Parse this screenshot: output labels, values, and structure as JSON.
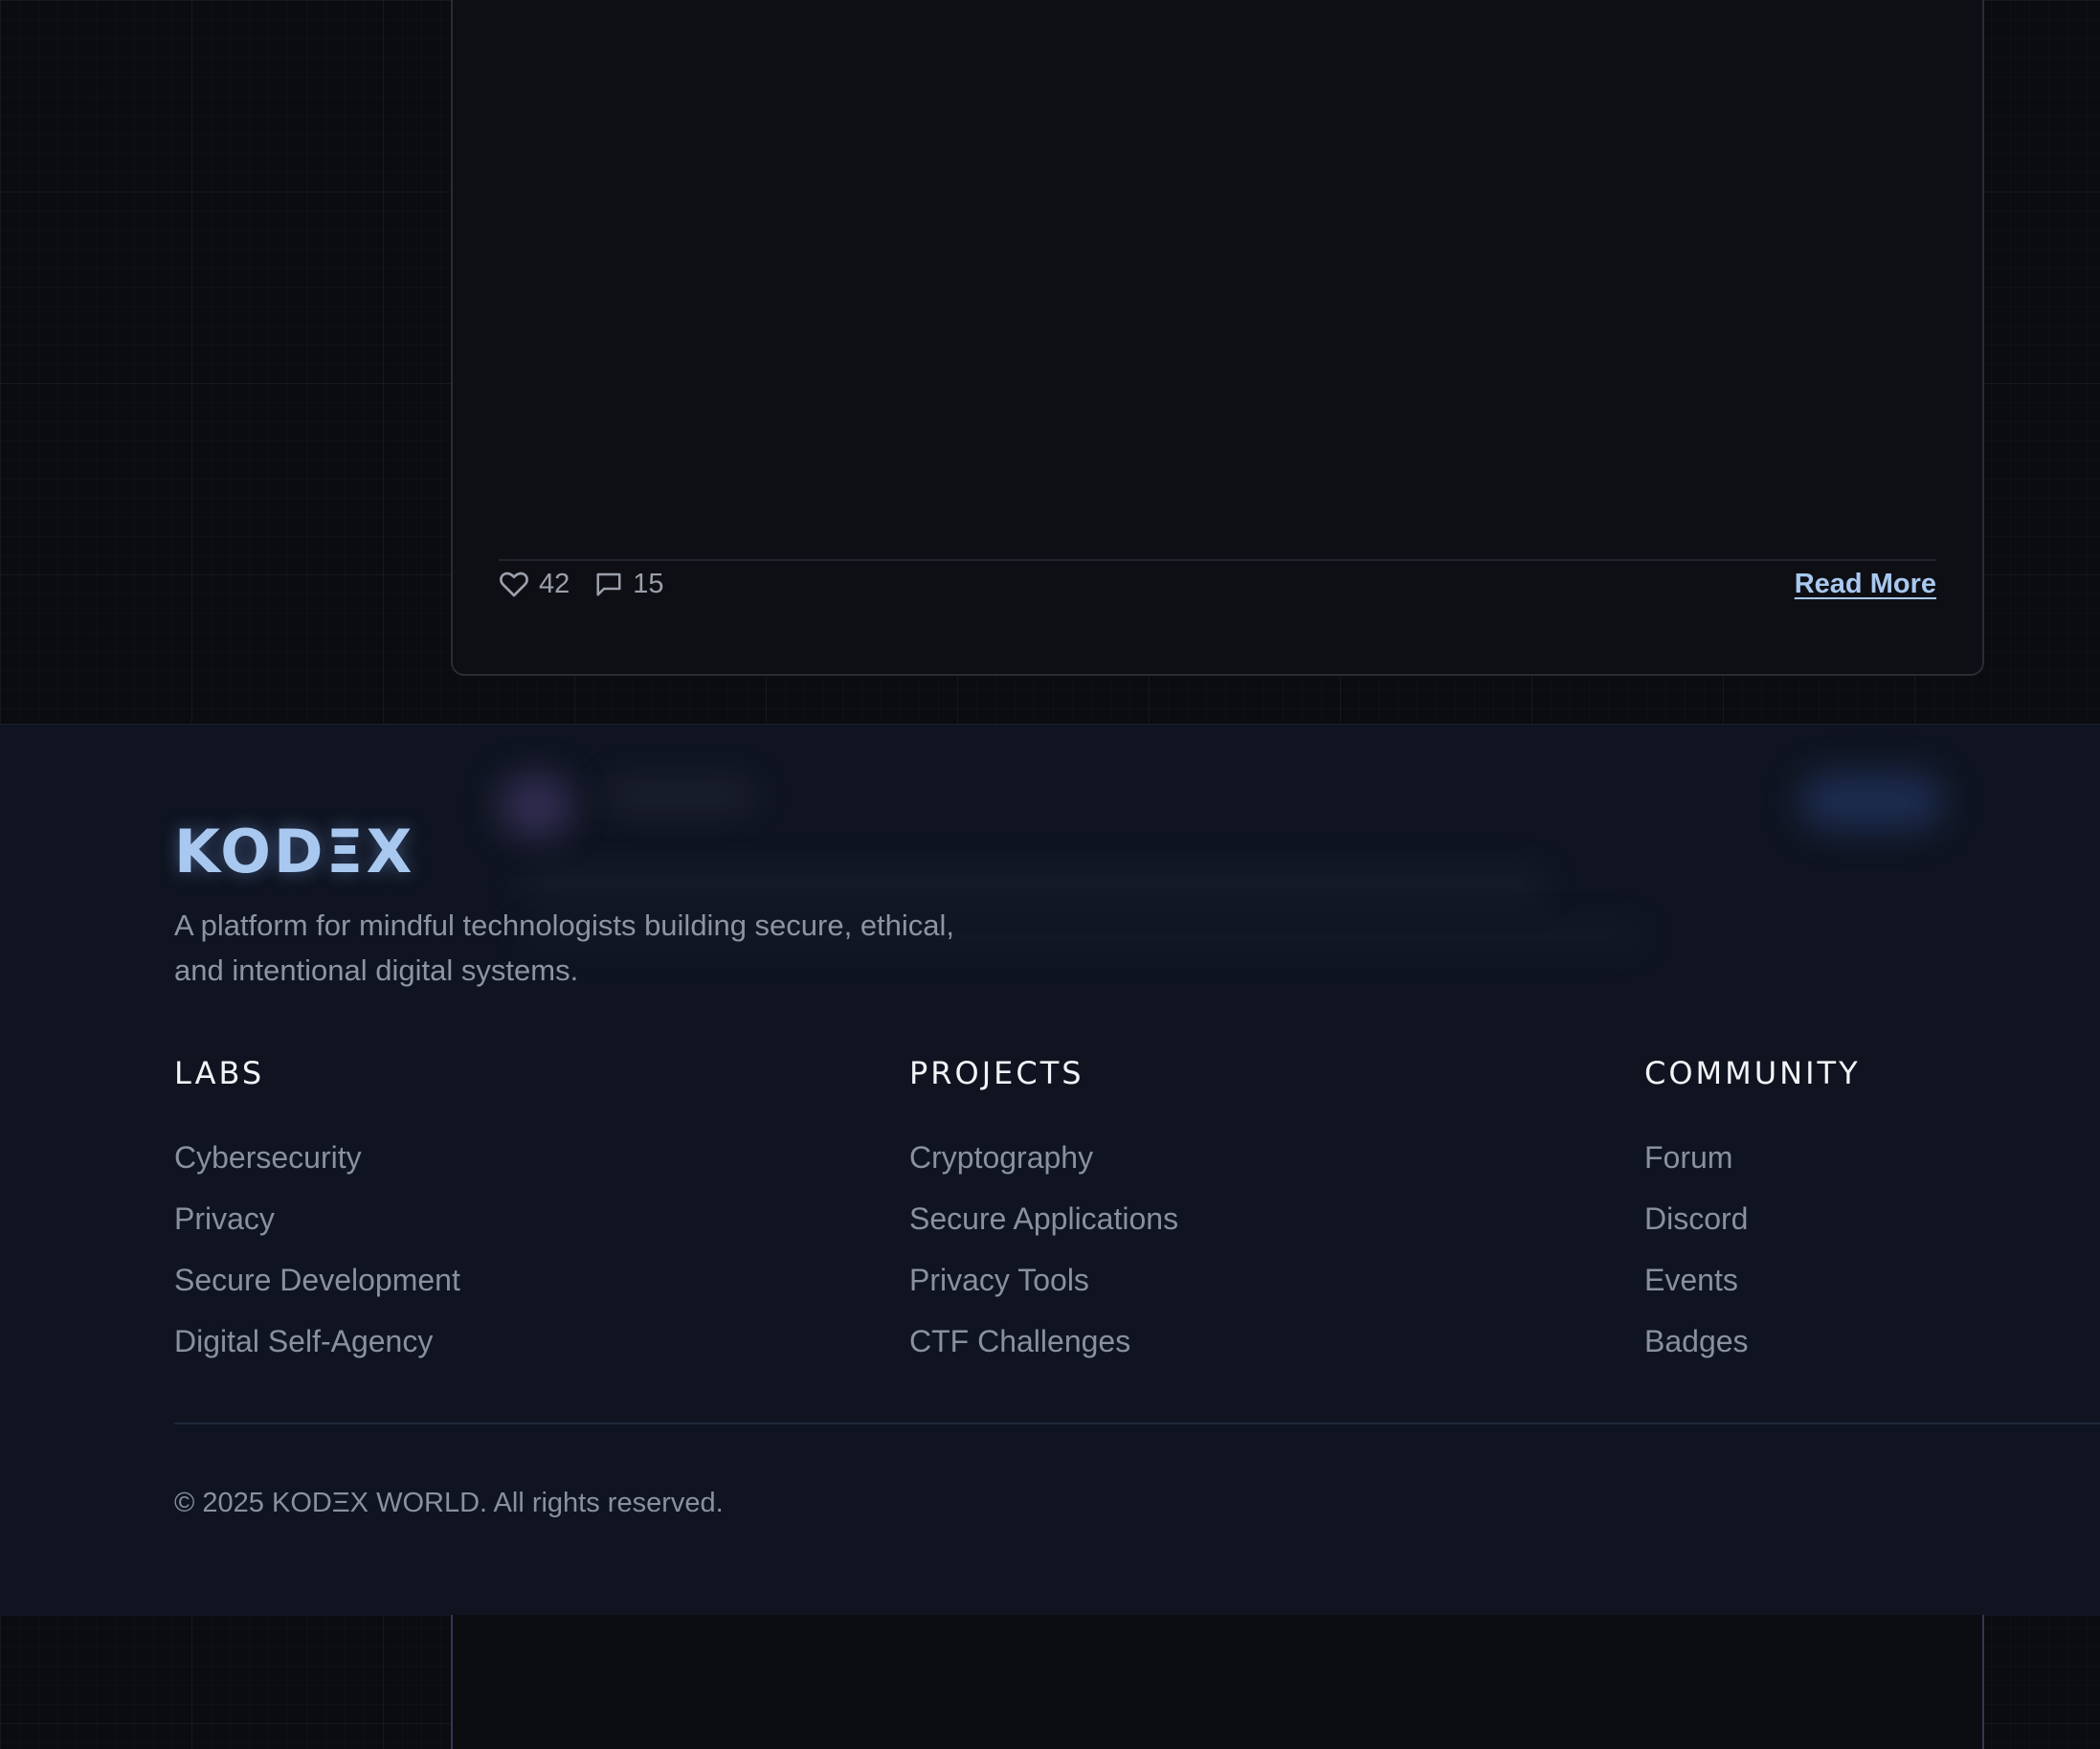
{
  "post_card": {
    "likes": "42",
    "comments": "15",
    "read_more_label": "Read More",
    "icons": {
      "like": "heart-icon",
      "comment": "comment-icon"
    }
  },
  "footer": {
    "logo": "KODΞX",
    "tagline": "A platform for mindful technologists building secure, ethical, and intentional digital systems.",
    "columns": [
      {
        "heading": "LABS",
        "links": [
          "Cybersecurity",
          "Privacy",
          "Secure Development",
          "Digital Self-Agency"
        ]
      },
      {
        "heading": "PROJECTS",
        "links": [
          "Cryptography",
          "Secure Applications",
          "Privacy Tools",
          "CTF Challenges"
        ]
      },
      {
        "heading": "COMMUNITY",
        "links": [
          "Forum",
          "Discord",
          "Events",
          "Badges"
        ]
      }
    ],
    "copyright": "© 2025 KODΞX WORLD. All rights reserved."
  },
  "colors": {
    "accent": "#a8c8f0",
    "background": "#0b0c10",
    "footer_background": "#0f1420",
    "card_background": "#0e0f14",
    "muted_text": "#8a909e",
    "heading_text": "#f2f4f8"
  }
}
